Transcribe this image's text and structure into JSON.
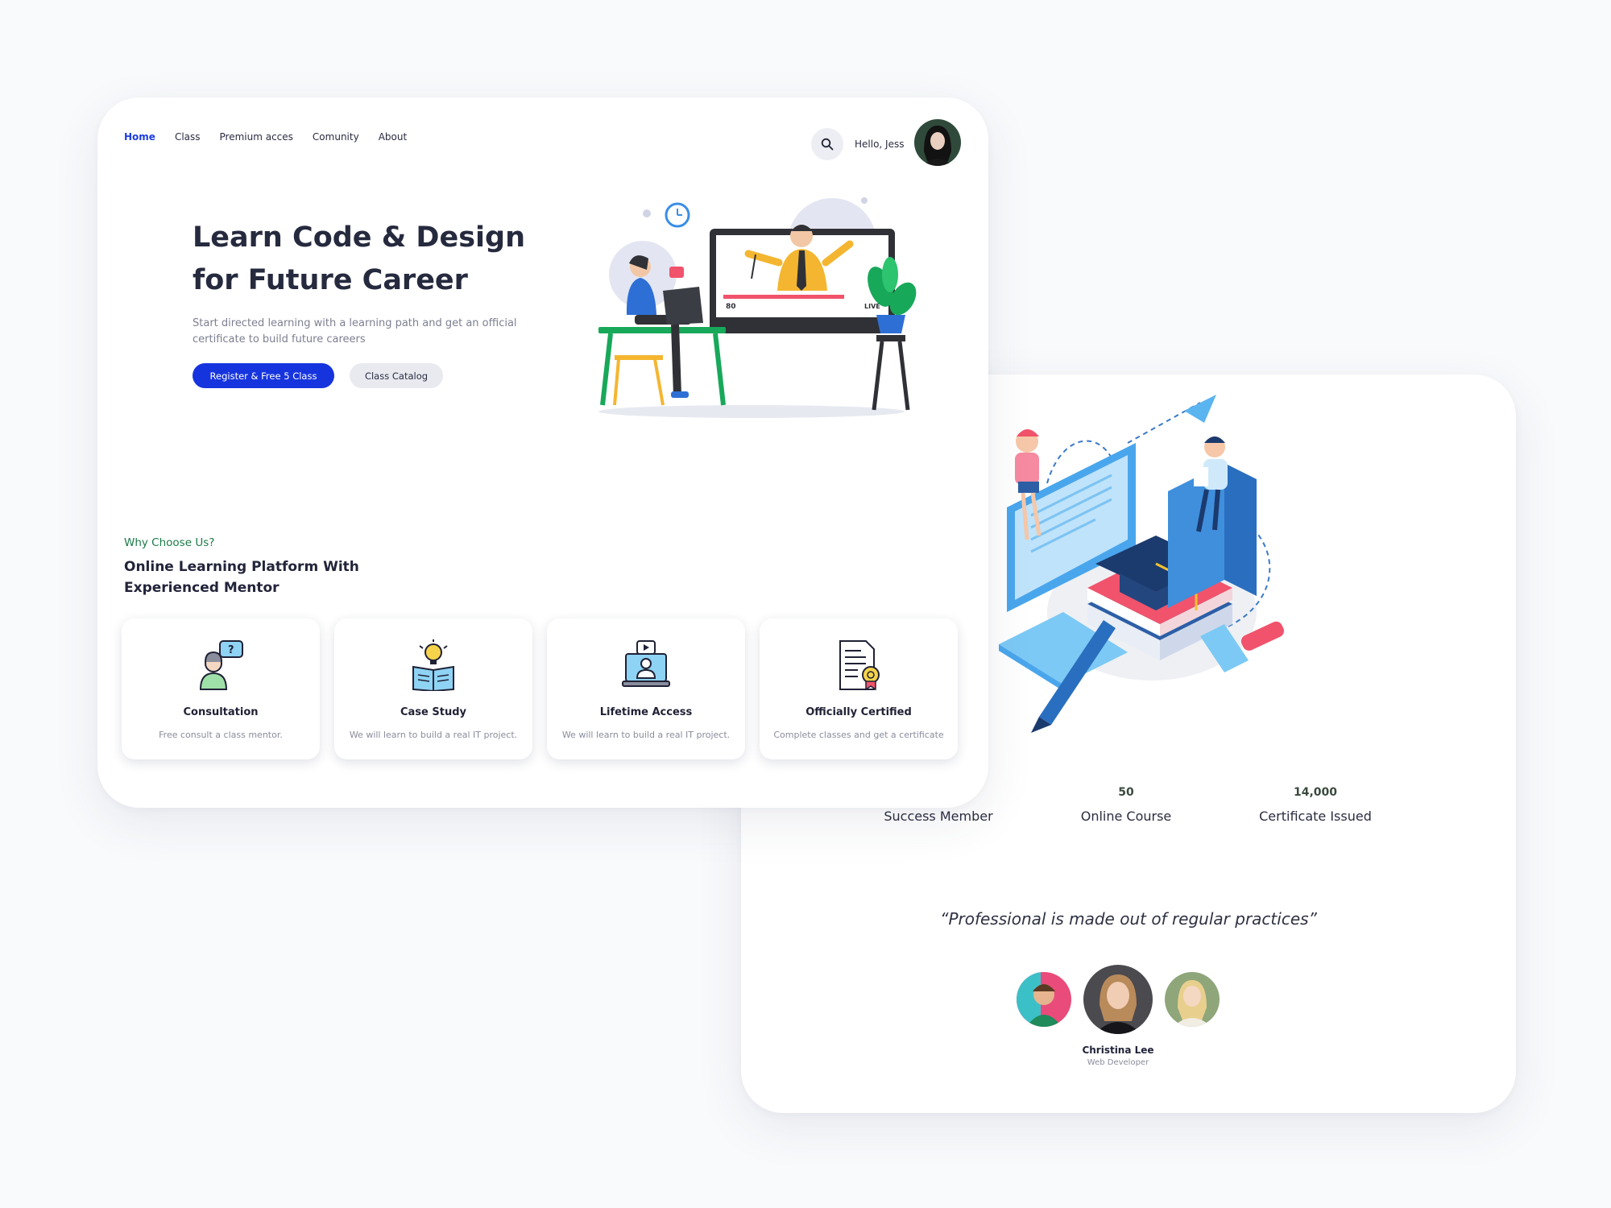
{
  "nav": {
    "items": [
      {
        "label": "Home",
        "active": true
      },
      {
        "label": "Class"
      },
      {
        "label": "Premium acces"
      },
      {
        "label": "Comunity"
      },
      {
        "label": "About"
      }
    ],
    "greeting": "Hello, Jess"
  },
  "hero": {
    "title": "Learn Code & Design for Future Career",
    "subtitle": "Start directed learning with a learning path  and get an official certificate to build future careers",
    "primary_button": "Register & Free 5 Class",
    "secondary_button": "Class Catalog",
    "video_badge_count": "80",
    "video_badge_live": "LIVE"
  },
  "why": {
    "kicker": "Why Choose Us?",
    "title": "Online Learning Platform With Experienced Mentor",
    "features": [
      {
        "icon": "consultation-icon",
        "title": "Consultation",
        "desc": "Free consult a class mentor."
      },
      {
        "icon": "case-study-icon",
        "title": "Case Study",
        "desc": "We will learn to build a real IT project."
      },
      {
        "icon": "lifetime-access-icon",
        "title": "Lifetime Access",
        "desc": "We will learn to build a real IT project."
      },
      {
        "icon": "certificate-icon",
        "title": "Officially Certified",
        "desc": "Complete classes and get a certificate"
      }
    ]
  },
  "stats": [
    {
      "value": "",
      "label": "Success Member"
    },
    {
      "value": "50",
      "label": "Online Course"
    },
    {
      "value": "14,000",
      "label": "Certificate Issued"
    }
  ],
  "testimonial": {
    "quote": "“Professional is made out of regular practices”",
    "name": "Christina Lee",
    "role": "Web Developer"
  },
  "colors": {
    "accent": "#1634de",
    "kicker_green": "#1a7a48",
    "background": "#f9fafc"
  }
}
